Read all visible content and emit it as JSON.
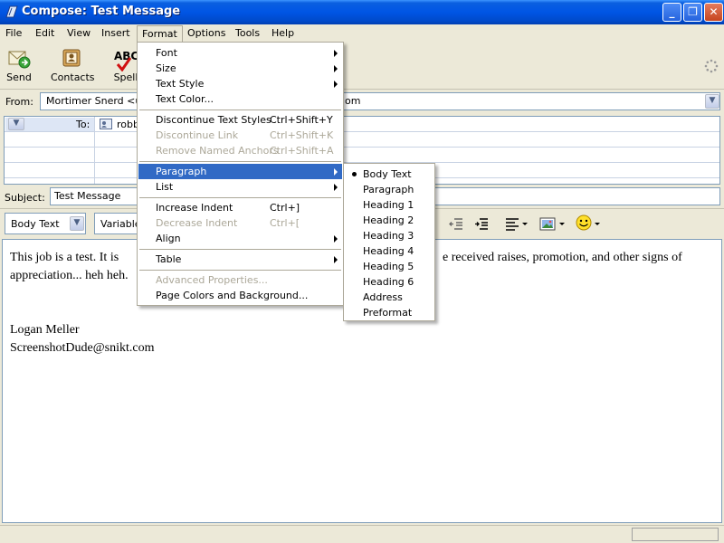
{
  "window": {
    "title": "Compose: Test Message"
  },
  "menubar": [
    "File",
    "Edit",
    "View",
    "Insert",
    "Format",
    "Options",
    "Tools",
    "Help"
  ],
  "toolbar": {
    "send": "Send",
    "contacts": "Contacts",
    "spell": "Spell",
    "spell_icon_text": "ABC"
  },
  "from": {
    "label": "From:",
    "value_left": "Mortimer Snerd <us",
    "value_right": "om"
  },
  "to": {
    "label": "To:",
    "value": "robb"
  },
  "subject": {
    "label": "Subject:",
    "value": "Test Message"
  },
  "format_bar": {
    "paragraph_style": "Body Text",
    "font": "Variable"
  },
  "body": {
    "line1_left": "This job is a test.  It is",
    "line1_right": "e received raises, promotion, and other signs of",
    "line2": "appreciation... heh heh.",
    "line3": "Logan Meller",
    "line4": "ScreenshotDude@snikt.com"
  },
  "format_menu": {
    "font": "Font",
    "size": "Size",
    "text_style": "Text Style",
    "text_color": "Text Color...",
    "discontinue_text_styles": "Discontinue Text Styles",
    "discontinue_text_styles_sc": "Ctrl+Shift+Y",
    "discontinue_link": "Discontinue Link",
    "discontinue_link_sc": "Ctrl+Shift+K",
    "remove_named_anchors": "Remove Named Anchors",
    "remove_named_anchors_sc": "Ctrl+Shift+A",
    "paragraph": "Paragraph",
    "list": "List",
    "increase_indent": "Increase Indent",
    "increase_indent_sc": "Ctrl+]",
    "decrease_indent": "Decrease Indent",
    "decrease_indent_sc": "Ctrl+[",
    "align": "Align",
    "table": "Table",
    "advanced_properties": "Advanced Properties...",
    "page_colors": "Page Colors and Background..."
  },
  "paragraph_menu": [
    "Body Text",
    "Paragraph",
    "Heading 1",
    "Heading 2",
    "Heading 3",
    "Heading 4",
    "Heading 5",
    "Heading 6",
    "Address",
    "Preformat"
  ],
  "colors": {
    "titlebar": "#0055e5",
    "menu_highlight": "#316ac5",
    "disabled_text": "#aca899"
  }
}
